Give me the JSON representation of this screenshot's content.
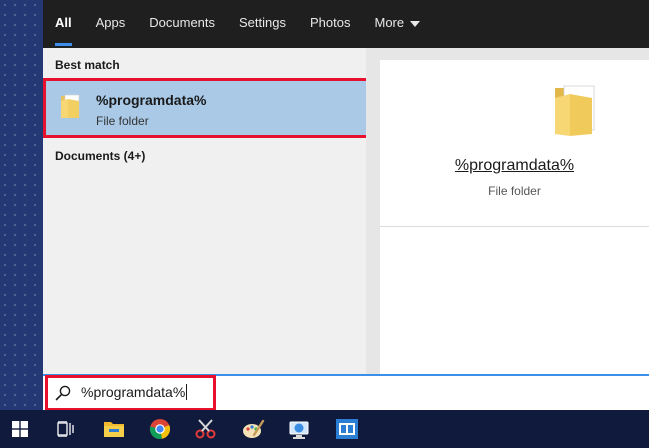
{
  "nav": {
    "tabs": [
      {
        "label": "All",
        "active": true
      },
      {
        "label": "Apps",
        "active": false
      },
      {
        "label": "Documents",
        "active": false
      },
      {
        "label": "Settings",
        "active": false
      },
      {
        "label": "Photos",
        "active": false
      },
      {
        "label": "More",
        "active": false
      }
    ]
  },
  "results": {
    "best_match_header": "Best match",
    "best_match": {
      "title": "%programdata%",
      "subtitle": "File folder",
      "icon": "folder-icon"
    },
    "documents_header": "Documents (4+)"
  },
  "preview": {
    "title": "%programdata%",
    "subtitle": "File folder",
    "icon": "folder-icon"
  },
  "search": {
    "value": "%programdata%",
    "icon": "search-icon"
  },
  "taskbar": {
    "items": [
      {
        "icon": "windows-start-icon"
      },
      {
        "icon": "task-view-icon"
      },
      {
        "icon": "file-explorer-icon"
      },
      {
        "icon": "chrome-icon"
      },
      {
        "icon": "snipping-tool-icon"
      },
      {
        "icon": "paint-icon"
      },
      {
        "icon": "remote-desktop-icon"
      },
      {
        "icon": "app-window-icon"
      }
    ]
  },
  "colors": {
    "accent": "#3b8eea",
    "selection": "#a9c9e7",
    "highlight_border": "#e8112d",
    "nav_bg": "#1f1f1f",
    "taskbar_bg": "#101a3c"
  }
}
